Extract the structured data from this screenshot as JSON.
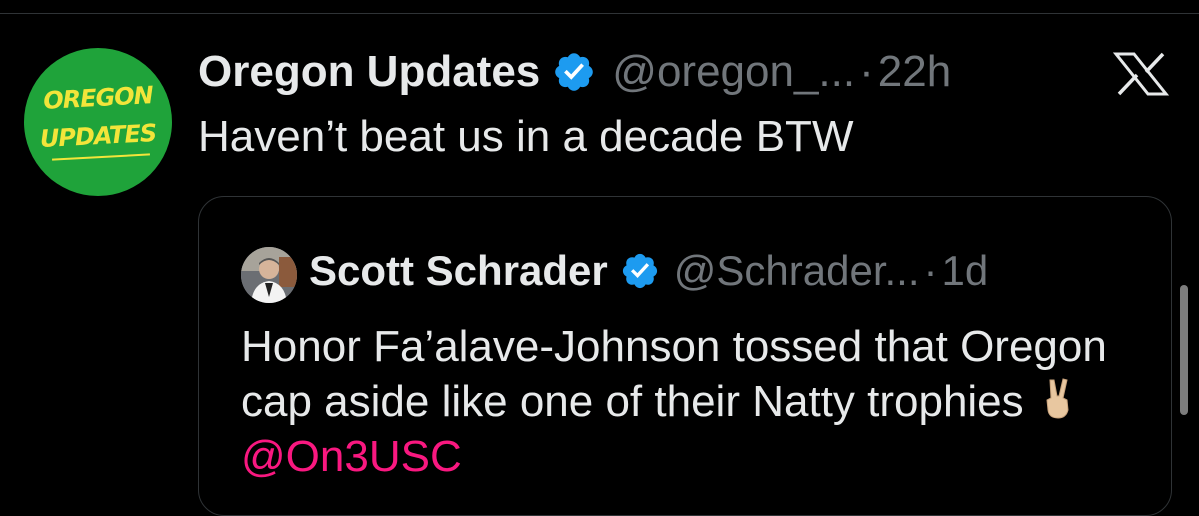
{
  "tweet": {
    "author_name": "Oregon Updates",
    "handle": "@oregon_...",
    "separator": "·",
    "time": "22h",
    "text": "Haven’t beat us in a decade BTW",
    "avatar_text": [
      "OREGON",
      "UPDATES"
    ]
  },
  "quoted_tweet": {
    "author_name": "Scott Schrader",
    "handle": "@Schrader...",
    "separator": "·",
    "time": "1d",
    "text": "Honor Fa’alave-Johnson tossed that Oregon cap aside like one of their Natty trophies",
    "mention": "@On3USC"
  },
  "icons": {
    "verified": "verified-badge-icon",
    "close": "x-logo-icon",
    "emoji": "victory-hand-emoji"
  },
  "colors": {
    "background": "#000000",
    "text": "#e7e9ea",
    "secondary_text": "#71767b",
    "verified_blue": "#1d9bf0",
    "mention_pink": "#f91880",
    "avatar_green": "#1fa33a",
    "avatar_yellow": "#f2e53a"
  }
}
